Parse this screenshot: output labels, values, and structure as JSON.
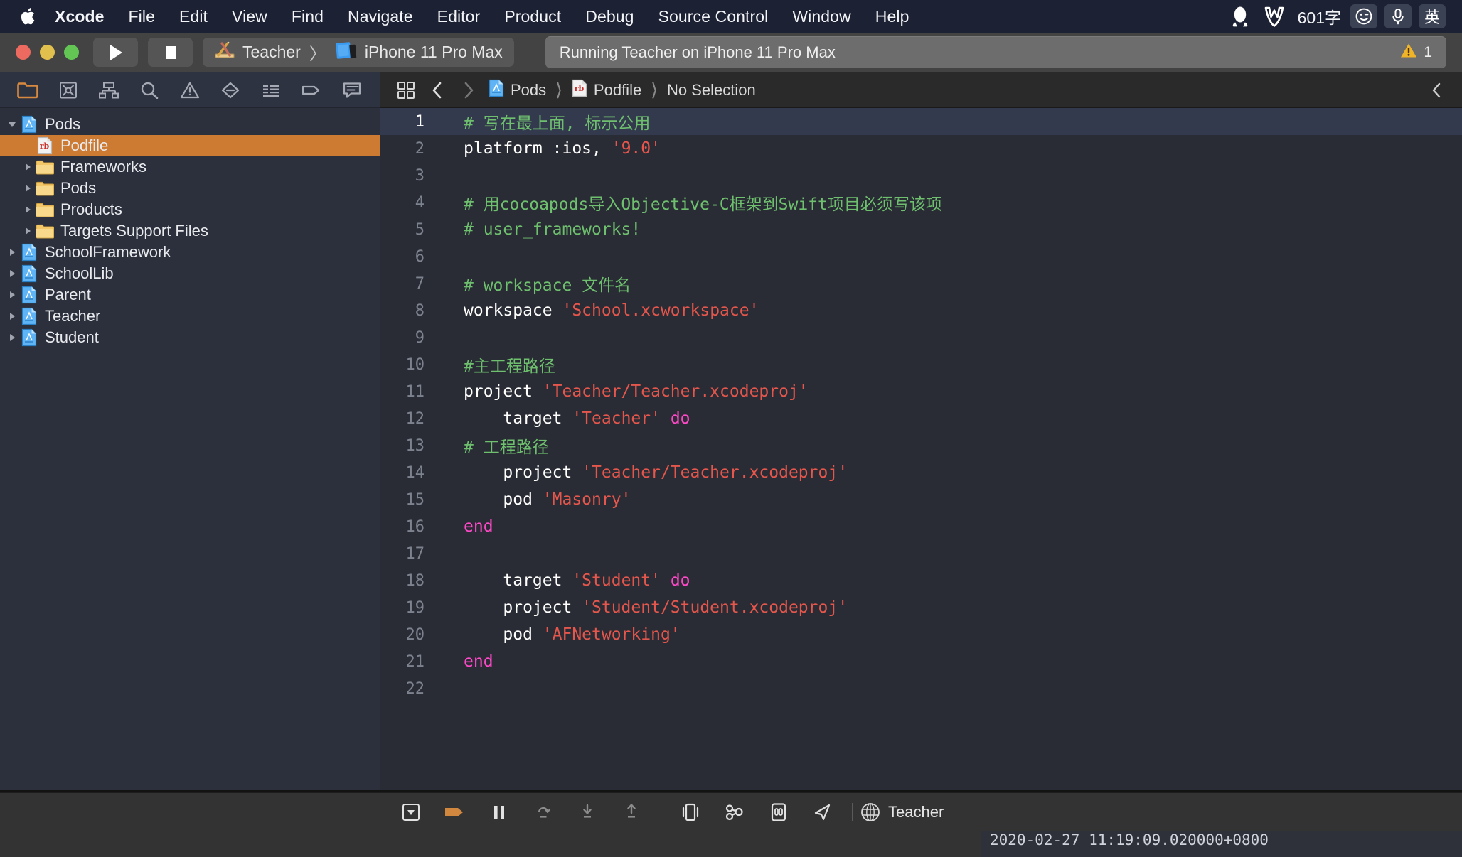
{
  "menubar": {
    "apple_icon": "apple-logo",
    "items": [
      {
        "label": "Xcode",
        "bold": true
      },
      {
        "label": "File"
      },
      {
        "label": "Edit"
      },
      {
        "label": "View"
      },
      {
        "label": "Find"
      },
      {
        "label": "Navigate"
      },
      {
        "label": "Editor"
      },
      {
        "label": "Product"
      },
      {
        "label": "Debug"
      },
      {
        "label": "Source Control"
      },
      {
        "label": "Window"
      },
      {
        "label": "Help"
      }
    ],
    "right": {
      "qq_icon": "penguin-icon",
      "w_icon": "w-logo-icon",
      "char_count": "601字",
      "emoji_icon": "wink-face-icon",
      "mic_icon": "microphone-icon",
      "input_method": "英"
    }
  },
  "toolbar": {
    "run_button": "run-triangle",
    "stop_button": "stop-square",
    "scheme": {
      "target": "Teacher",
      "separator": "〉",
      "device": "iPhone 11 Pro Max"
    },
    "status": "Running Teacher on iPhone 11 Pro Max",
    "warning_count": "1"
  },
  "navigator": {
    "tabs": [
      {
        "name": "project-navigator",
        "icon": "folder-icon",
        "active": true
      },
      {
        "name": "source-control-navigator",
        "icon": "source-control-icon",
        "active": false
      },
      {
        "name": "symbol-navigator",
        "icon": "hierarchy-icon",
        "active": false
      },
      {
        "name": "find-navigator",
        "icon": "search-icon",
        "active": false
      },
      {
        "name": "issue-navigator",
        "icon": "warning-triangle-icon",
        "active": false
      },
      {
        "name": "test-navigator",
        "icon": "diamond-minus-icon",
        "active": false
      },
      {
        "name": "debug-navigator",
        "icon": "report-lines-icon",
        "active": false
      },
      {
        "name": "breakpoint-navigator",
        "icon": "pennant-tag-icon",
        "active": false
      },
      {
        "name": "report-navigator",
        "icon": "speech-bubble-icon",
        "active": false
      }
    ],
    "tree": [
      {
        "label": "Pods",
        "icon": "xcode-project-icon",
        "depth": 0,
        "twisty": "down",
        "selected": false
      },
      {
        "label": "Podfile",
        "icon": "ruby-file-icon",
        "depth": 1,
        "twisty": "none",
        "selected": true
      },
      {
        "label": "Frameworks",
        "icon": "folder-yellow-icon",
        "depth": 1,
        "twisty": "right",
        "selected": false
      },
      {
        "label": "Pods",
        "icon": "folder-yellow-icon",
        "depth": 1,
        "twisty": "right",
        "selected": false
      },
      {
        "label": "Products",
        "icon": "folder-yellow-icon",
        "depth": 1,
        "twisty": "right",
        "selected": false
      },
      {
        "label": "Targets Support Files",
        "icon": "folder-yellow-icon",
        "depth": 1,
        "twisty": "right",
        "selected": false
      },
      {
        "label": "SchoolFramework",
        "icon": "xcode-project-icon",
        "depth": 0,
        "twisty": "right",
        "selected": false
      },
      {
        "label": "SchoolLib",
        "icon": "xcode-project-icon",
        "depth": 0,
        "twisty": "right",
        "selected": false
      },
      {
        "label": "Parent",
        "icon": "xcode-project-icon",
        "depth": 0,
        "twisty": "right",
        "selected": false
      },
      {
        "label": "Teacher",
        "icon": "xcode-project-icon",
        "depth": 0,
        "twisty": "right",
        "selected": false
      },
      {
        "label": "Student",
        "icon": "xcode-project-icon",
        "depth": 0,
        "twisty": "right",
        "selected": false
      }
    ]
  },
  "jumpbar": {
    "grid_icon": "related-items-icon",
    "back_icon": "chevron-left-icon",
    "forward_icon": "chevron-right-icon",
    "crumbs": [
      {
        "label": "Pods",
        "icon": "xcode-project-icon"
      },
      {
        "label": "Podfile",
        "icon": "ruby-file-icon"
      },
      {
        "label": "No Selection",
        "icon": "none"
      }
    ],
    "collapse_icon": "chevron-left-icon"
  },
  "editor": {
    "filename": "Podfile",
    "current_line": 1,
    "lines": [
      {
        "n": 1,
        "tokens": [
          {
            "t": "# 写在最上面, 标示公用",
            "c": "c"
          }
        ]
      },
      {
        "n": 2,
        "tokens": [
          {
            "t": "platform :ios, ",
            "c": "p"
          },
          {
            "t": "'9.0'",
            "c": "s"
          }
        ]
      },
      {
        "n": 3,
        "tokens": []
      },
      {
        "n": 4,
        "tokens": [
          {
            "t": "# 用cocoapods导入Objective-C框架到Swift项目必须写该项",
            "c": "c"
          }
        ]
      },
      {
        "n": 5,
        "tokens": [
          {
            "t": "# user_frameworks!",
            "c": "c"
          }
        ]
      },
      {
        "n": 6,
        "tokens": []
      },
      {
        "n": 7,
        "tokens": [
          {
            "t": "# workspace 文件名",
            "c": "c"
          }
        ]
      },
      {
        "n": 8,
        "tokens": [
          {
            "t": "workspace ",
            "c": "p"
          },
          {
            "t": "'School.xcworkspace'",
            "c": "s"
          }
        ]
      },
      {
        "n": 9,
        "tokens": []
      },
      {
        "n": 10,
        "tokens": [
          {
            "t": "#主工程路径",
            "c": "c"
          }
        ]
      },
      {
        "n": 11,
        "tokens": [
          {
            "t": "project ",
            "c": "p"
          },
          {
            "t": "'Teacher/Teacher.xcodeproj'",
            "c": "s"
          }
        ]
      },
      {
        "n": 12,
        "tokens": [
          {
            "t": "    target ",
            "c": "p"
          },
          {
            "t": "'Teacher'",
            "c": "s"
          },
          {
            "t": " ",
            "c": "p"
          },
          {
            "t": "do",
            "c": "k"
          }
        ]
      },
      {
        "n": 13,
        "tokens": [
          {
            "t": "# 工程路径",
            "c": "c"
          }
        ]
      },
      {
        "n": 14,
        "tokens": [
          {
            "t": "    project ",
            "c": "p"
          },
          {
            "t": "'Teacher/Teacher.xcodeproj'",
            "c": "s"
          }
        ]
      },
      {
        "n": 15,
        "tokens": [
          {
            "t": "    pod ",
            "c": "p"
          },
          {
            "t": "'Masonry'",
            "c": "s"
          }
        ]
      },
      {
        "n": 16,
        "tokens": [
          {
            "t": "end",
            "c": "k"
          }
        ]
      },
      {
        "n": 17,
        "tokens": []
      },
      {
        "n": 18,
        "tokens": [
          {
            "t": "    target ",
            "c": "p"
          },
          {
            "t": "'Student'",
            "c": "s"
          },
          {
            "t": " ",
            "c": "p"
          },
          {
            "t": "do",
            "c": "k"
          }
        ]
      },
      {
        "n": 19,
        "tokens": [
          {
            "t": "    project ",
            "c": "p"
          },
          {
            "t": "'Student/Student.xcodeproj'",
            "c": "s"
          }
        ]
      },
      {
        "n": 20,
        "tokens": [
          {
            "t": "    pod ",
            "c": "p"
          },
          {
            "t": "'AFNetworking'",
            "c": "s"
          }
        ]
      },
      {
        "n": 21,
        "tokens": [
          {
            "t": "end",
            "c": "k"
          }
        ]
      },
      {
        "n": 22,
        "tokens": []
      }
    ]
  },
  "debugbar": {
    "buttons": [
      {
        "name": "hide-debug-area-button",
        "icon": "panel-down-icon",
        "accent": false
      },
      {
        "name": "activate-breakpoints-button",
        "icon": "breakpoint-pennant-icon",
        "accent": true
      },
      {
        "name": "pause-button",
        "icon": "pause-icon",
        "accent": false
      },
      {
        "name": "step-over-button",
        "icon": "step-over-icon",
        "accent": false
      },
      {
        "name": "step-into-button",
        "icon": "step-into-icon",
        "accent": false
      },
      {
        "name": "step-out-button",
        "icon": "step-out-icon",
        "accent": false
      },
      {
        "name": "debug-view-hierarchy-button",
        "icon": "view-hierarchy-icon",
        "accent": false
      },
      {
        "name": "memory-graph-button",
        "icon": "memory-graph-icon",
        "accent": false
      },
      {
        "name": "simulate-keyboard-button",
        "icon": "device-keyboard-icon",
        "accent": false
      },
      {
        "name": "simulate-location-button",
        "icon": "location-arrow-icon",
        "accent": false
      }
    ],
    "process_icon": "globe-icon",
    "process_label": "Teacher"
  },
  "console": {
    "output": "2020-02-27 11:19:09.020000+0800"
  },
  "colors": {
    "accent_orange": "#cd7a33",
    "breakpoint_orange": "#d2873f",
    "comment_green": "#6ec06e",
    "string_red": "#e5564c",
    "keyword_magenta": "#ff49c8",
    "editor_bg": "#292c34",
    "navigator_bg": "#2b303c",
    "toolbar_bg": "#434343",
    "menubar_bg": "#1c2133",
    "warning_yellow": "#f0b429"
  }
}
